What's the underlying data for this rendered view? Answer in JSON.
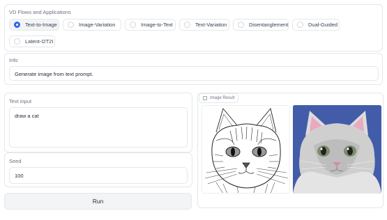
{
  "flows": {
    "title": "VD Flows and Applications",
    "options": [
      {
        "label": "Text-to-Image",
        "selected": true
      },
      {
        "label": "Image-Variation",
        "selected": false
      },
      {
        "label": "Image-to-Text",
        "selected": false
      },
      {
        "label": "Text-Variation",
        "selected": false
      },
      {
        "label": "Disentanglement",
        "selected": false
      },
      {
        "label": "Dual-Guided",
        "selected": false
      },
      {
        "label": "Latent-I2T2I",
        "selected": false
      }
    ]
  },
  "info": {
    "label": "Info",
    "value": "Generate image from text prompt."
  },
  "text_input": {
    "label": "Text input",
    "value": "draw a cat"
  },
  "seed": {
    "label": "Seed",
    "value": "100"
  },
  "run_button": {
    "label": "Run"
  },
  "image_result": {
    "label": "Image Result"
  },
  "colors": {
    "accent": "#2563eb",
    "border": "#e5e7eb",
    "button_bg": "#f3f4f6",
    "image2_bg": "#3f5aa8"
  }
}
